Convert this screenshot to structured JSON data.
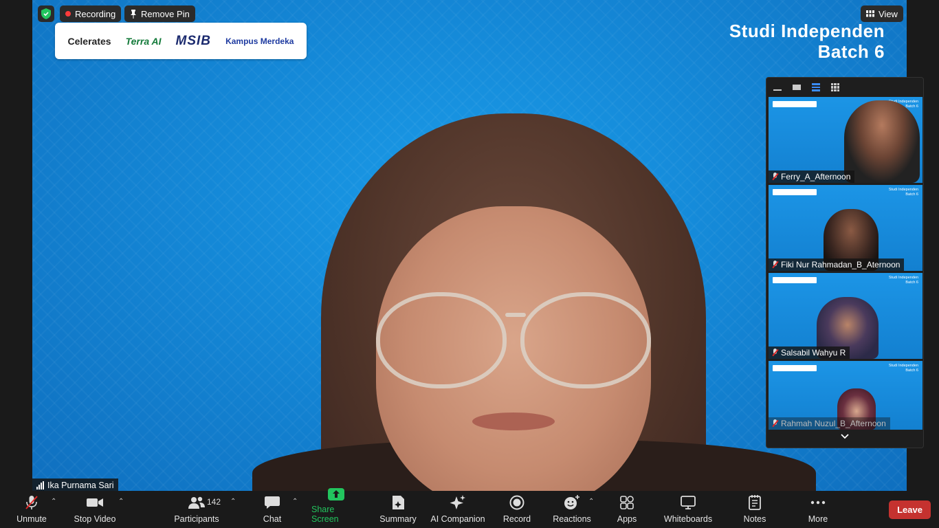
{
  "overlay": {
    "recording_label": "Recording",
    "remove_pin_label": "Remove Pin",
    "view_label": "View"
  },
  "main_video": {
    "slide_title_line1": "Studi Independen",
    "slide_title_line2": "Batch 6",
    "logos": [
      "Celerates",
      "Terra AI",
      "MSIB",
      "Kampus Merdeka"
    ],
    "speaker_name": "Ika Purnama Sari"
  },
  "gallery": {
    "tiles": [
      {
        "name": "Ferry_A_Afternoon",
        "muted": true
      },
      {
        "name": "Fiki Nur Rahmadan_B_Aternoon",
        "muted": true
      },
      {
        "name": "Salsabil Wahyu R",
        "muted": true
      },
      {
        "name": "Rahmah Nuzul_B_Afternoon",
        "muted": true
      }
    ]
  },
  "toolbar": {
    "unmute": "Unmute",
    "stop_video": "Stop Video",
    "participants": "Participants",
    "participant_count": "142",
    "chat": "Chat",
    "share_screen": "Share Screen",
    "summary": "Summary",
    "ai_companion": "AI Companion",
    "record": "Record",
    "reactions": "Reactions",
    "apps": "Apps",
    "whiteboards": "Whiteboards",
    "notes": "Notes",
    "more": "More",
    "leave": "Leave"
  },
  "colors": {
    "share_screen_green": "#22c55e",
    "leave_red": "#c5322f",
    "recording_dot": "#ff3b3b",
    "slide_blue": "#1487d6"
  }
}
